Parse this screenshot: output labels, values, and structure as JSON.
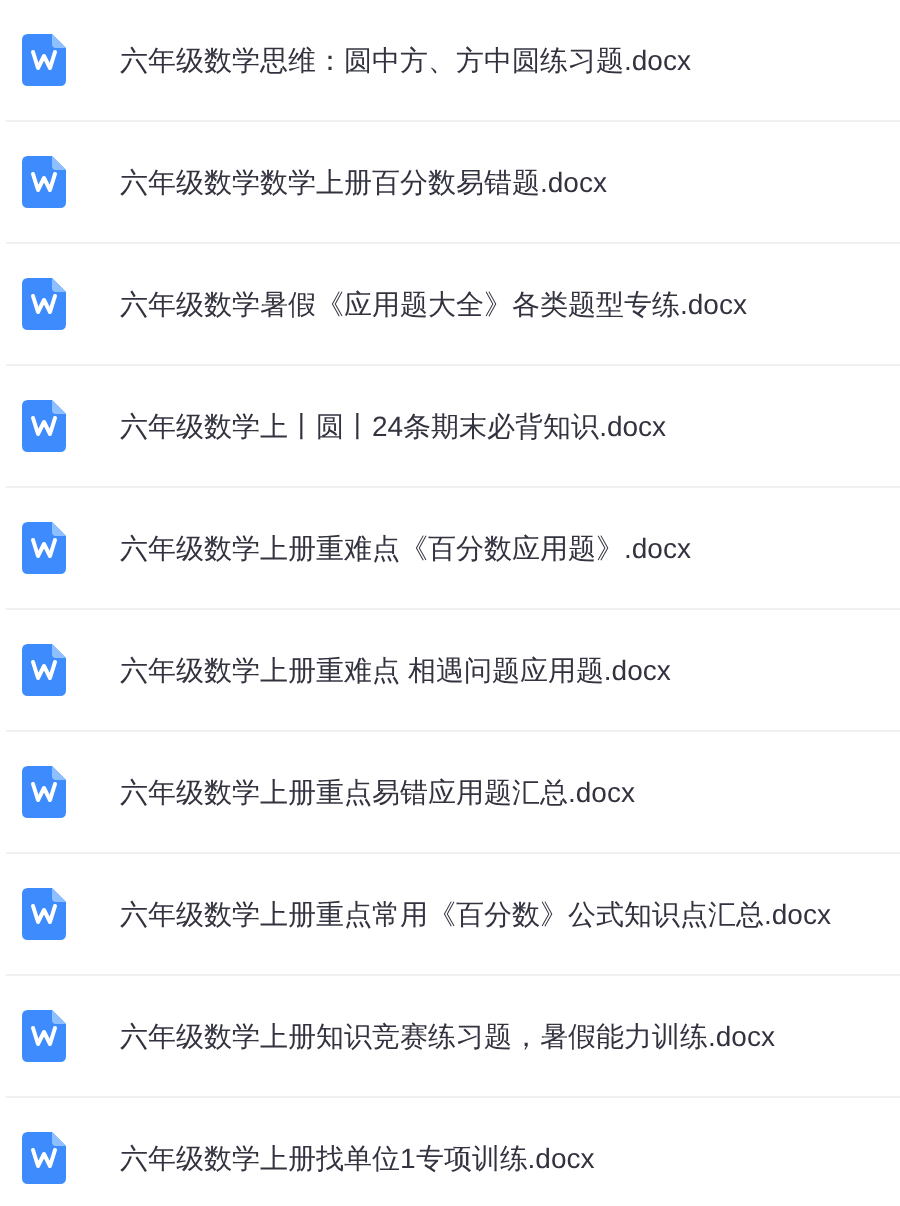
{
  "files": [
    {
      "name": "六年级数学思维：圆中方、方中圆练习题.docx"
    },
    {
      "name": "六年级数学数学上册百分数易错题.docx"
    },
    {
      "name": "六年级数学暑假《应用题大全》各类题型专练.docx"
    },
    {
      "name": "六年级数学上丨圆丨24条期末必背知识.docx"
    },
    {
      "name": "六年级数学上册重难点《百分数应用题》.docx"
    },
    {
      "name": "六年级数学上册重难点 相遇问题应用题.docx"
    },
    {
      "name": "六年级数学上册重点易错应用题汇总.docx"
    },
    {
      "name": "六年级数学上册重点常用《百分数》公式知识点汇总.docx"
    },
    {
      "name": "六年级数学上册知识竞赛练习题，暑假能力训练.docx"
    },
    {
      "name": "六年级数学上册找单位1专项训练.docx"
    }
  ]
}
